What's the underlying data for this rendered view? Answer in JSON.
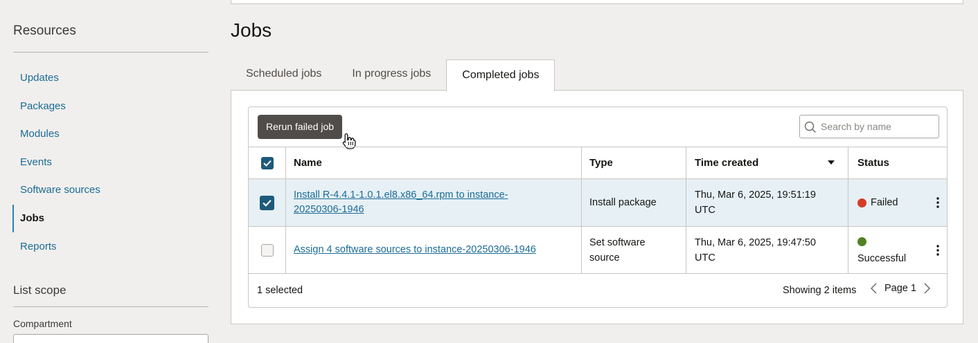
{
  "sidebar": {
    "title": "Resources",
    "items": [
      {
        "label": "Updates",
        "active": false
      },
      {
        "label": "Packages",
        "active": false
      },
      {
        "label": "Modules",
        "active": false
      },
      {
        "label": "Events",
        "active": false
      },
      {
        "label": "Software sources",
        "active": false
      },
      {
        "label": "Jobs",
        "active": true
      },
      {
        "label": "Reports",
        "active": false
      }
    ],
    "scope_title": "List scope",
    "compartment_label": "Compartment"
  },
  "main": {
    "title": "Jobs",
    "tabs": [
      {
        "label": "Scheduled jobs",
        "active": false
      },
      {
        "label": "In progress jobs",
        "active": false
      },
      {
        "label": "Completed jobs",
        "active": true
      }
    ],
    "toolbar": {
      "rerun_label": "Rerun failed job",
      "search_placeholder": "Search by name"
    },
    "table": {
      "headers": {
        "name": "Name",
        "type": "Type",
        "time": "Time created",
        "status": "Status"
      },
      "header_checked": true,
      "rows": [
        {
          "checked": true,
          "name": "Install R-4.4.1-1.0.1.el8.x86_64.rpm to instance-20250306-1946",
          "name_line1": "Install R-4.4.1-1.0.1.el8.x86_64.rpm to instance-",
          "name_line2": "20250306-1946",
          "type": "Install package",
          "type_line1": "Install package",
          "type_line2": "",
          "time_line1": "Thu, Mar 6, 2025, 19:51:19",
          "time_line2": "UTC",
          "status": "Failed",
          "status_color": "#d63b25"
        },
        {
          "checked": false,
          "name": "Assign 4 software sources to instance-20250306-1946",
          "name_line1": "Assign 4 software sources to instance-20250306-1946",
          "name_line2": "",
          "type_line1": "Set software",
          "type_line2": "source",
          "time_line1": "Thu, Mar 6, 2025, 19:47:50",
          "time_line2": "UTC",
          "status": "Successful",
          "status_color": "#508223"
        }
      ]
    },
    "footer": {
      "selected": "1 selected",
      "showing": "Showing 2 items",
      "page": "Page 1"
    }
  },
  "colors": {
    "accent": "#1a6b96",
    "checkbox": "#1d5a7c",
    "selected_row": "#e6f0f5",
    "button": "#4f4c49"
  },
  "icons": {
    "search": "search-icon",
    "sort": "caret-down-icon",
    "row_menu": "kebab-menu-icon",
    "prev": "chevron-left-icon",
    "next": "chevron-right-icon",
    "cursor": "hand-pointer-icon"
  }
}
